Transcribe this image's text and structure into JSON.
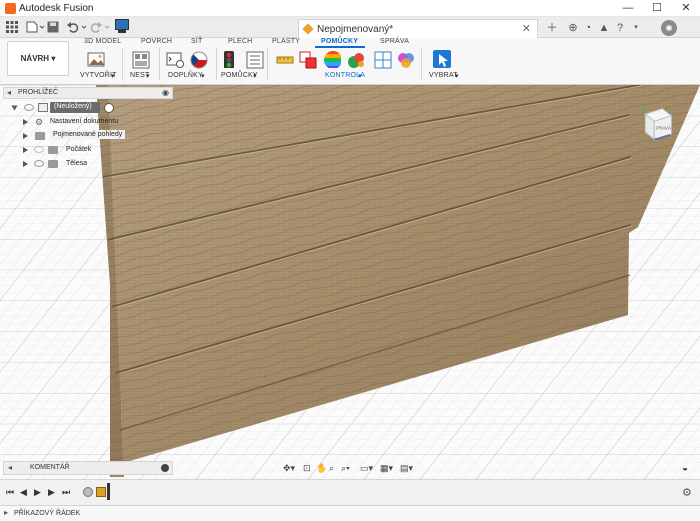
{
  "window": {
    "title": "Autodesk Fusion",
    "controls": {
      "minimize": "—",
      "maximize": "☐",
      "close": "✕"
    }
  },
  "tabbar": {
    "document_tab": "Nepojmenovaný*",
    "icons": [
      "grid-icon",
      "file-icon",
      "save-icon",
      "undo-icon",
      "redo-icon",
      "job-status-icon"
    ]
  },
  "ribbon": {
    "workspace": "NÁVRH",
    "tabs": [
      "3D MODEL",
      "POVRCH",
      "SÍŤ",
      "PLECH",
      "PLASTY",
      "POMŮCKY",
      "SPRÁVA"
    ],
    "active_tab": "POMŮCKY",
    "groups": [
      "VYTVOŘIT",
      "NEST",
      "DOPLŇKY",
      "POMŮCKY",
      "KONTROLA",
      "VYBRAT"
    ],
    "accent_color": "#0b6bd3"
  },
  "browser": {
    "title": "PROHLÍŽEČ",
    "root": "(Neuložený)",
    "items": [
      "Nastavení dokumentu",
      "Pojmenované pohledy",
      "Počátek",
      "Tělesa"
    ]
  },
  "viewcube": {
    "label": "PRAVÁ"
  },
  "comments": {
    "label": "KOMENTÁŘ"
  },
  "command_line": {
    "label": "PŘÍKAZOVÝ ŘÁDEK"
  }
}
